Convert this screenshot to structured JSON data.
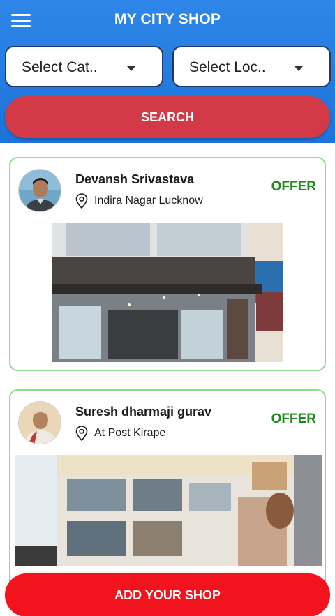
{
  "header": {
    "title": "MY CITY SHOP",
    "menu_icon": "hamburger-menu-icon",
    "background": "#2f86e8"
  },
  "filters": {
    "category": {
      "selected": "Select Cat..",
      "icon": "dropdown-caret-icon"
    },
    "location": {
      "selected": "Select Loc..",
      "icon": "dropdown-caret-icon"
    }
  },
  "search": {
    "label": "SEARCH",
    "color": "#d23a48"
  },
  "shops": [
    {
      "owner": "Devansh Srivastava",
      "address": "Indira Nagar Lucknow",
      "offer_label": "OFFER",
      "address_icon": "location-pin-icon"
    },
    {
      "owner": "Suresh dharmaji gurav",
      "address": "At Post Kirape",
      "offer_label": "OFFER",
      "address_icon": "location-pin-icon"
    }
  ],
  "footer": {
    "add_shop_label": "ADD YOUR SHOP",
    "color": "#f2131f"
  },
  "colors": {
    "offer": "#1e8a1e",
    "card_border": "#8fdc8a"
  }
}
